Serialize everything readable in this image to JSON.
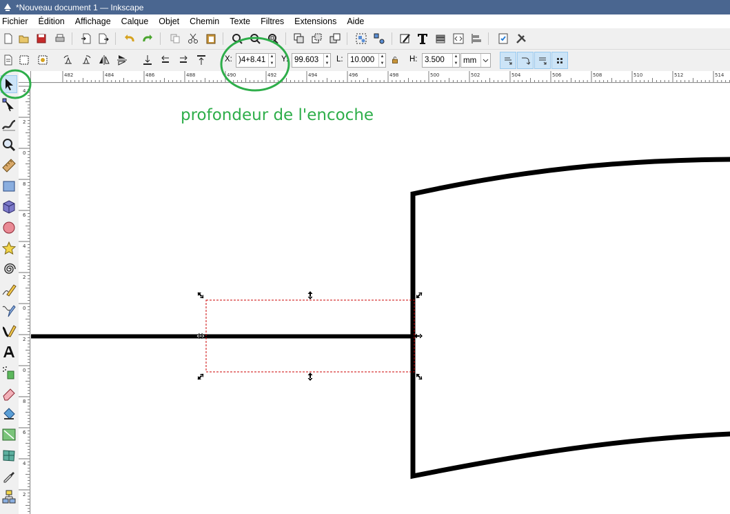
{
  "window": {
    "title": "*Nouveau document 1 — Inkscape"
  },
  "menu": {
    "items": [
      "Fichier",
      "Édition",
      "Affichage",
      "Calque",
      "Objet",
      "Chemin",
      "Texte",
      "Filtres",
      "Extensions",
      "Aide"
    ]
  },
  "commands_toolbar": {
    "icons": [
      "new-document-icon",
      "open-icon",
      "save-icon",
      "print-icon",
      "import-icon",
      "export-icon",
      "undo-icon",
      "redo-icon",
      "copy-icon",
      "cut-icon",
      "paste-icon",
      "zoom-selection-icon",
      "zoom-drawing-icon",
      "zoom-page-icon",
      "duplicate-icon",
      "clone-icon",
      "unlink-clone-icon",
      "group-icon",
      "ungroup-icon",
      "fill-stroke-icon",
      "text-font-icon",
      "layers-icon",
      "xml-editor-icon",
      "align-distribute-icon",
      "document-properties-icon",
      "preferences-icon"
    ]
  },
  "tool_controls": {
    "x_label": "X:",
    "x_value": ")4+8.41",
    "y_label": "Y:",
    "y_value": "99.603",
    "w_label": "L:",
    "w_value": "10.000",
    "h_label": "H:",
    "h_value": "3.500",
    "unit": "mm"
  },
  "ruler": {
    "top_labels": [
      "482",
      "484",
      "486",
      "488",
      "490",
      "492",
      "494",
      "496",
      "498",
      "500",
      "502",
      "504",
      "506",
      "508",
      "510",
      "512",
      "514"
    ],
    "left_labels": [
      "4",
      "2",
      "0",
      "8",
      "6",
      "4",
      "2",
      "0",
      "2",
      "0",
      "8",
      "6",
      "4",
      "2"
    ]
  },
  "canvas": {
    "annotation": "profondeur de l'encoche",
    "annotation_color": "#2eae4a"
  },
  "colors": {
    "titlebar": "#4a6690",
    "selection_dash": "#cc0000",
    "active_tool": "#cce4f7"
  }
}
